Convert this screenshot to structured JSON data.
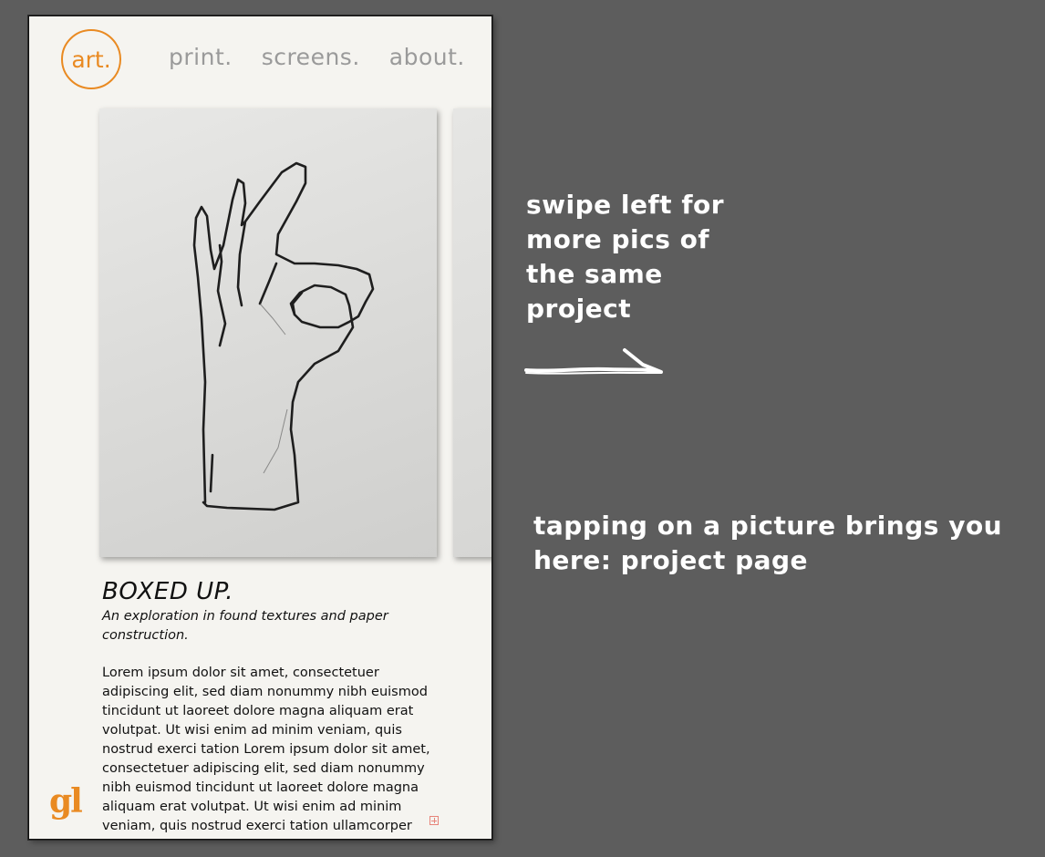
{
  "phone": {
    "logo": "art.",
    "nav": [
      "print.",
      "screens.",
      "about."
    ],
    "project": {
      "title": "BOXED UP.",
      "subtitle": "An exploration in found textures and paper construction.",
      "body": "Lorem ipsum dolor sit amet, consectetuer adipiscing elit, sed diam nonummy nibh euismod tincidunt ut laoreet dolore magna aliquam erat volutpat. Ut wisi enim ad minim veniam, quis nostrud exerci tation Lorem ipsum dolor sit amet, consectetuer adipiscing elit, sed diam nonummy nibh euismod tincidunt ut laoreet dolore magna aliquam erat volutpat. Ut wisi enim ad minim veniam, quis nostrud exerci tation ullamcorper"
    },
    "footer_logo": "gl"
  },
  "annotations": {
    "swipe": "swipe left for more pics of the same project",
    "tap": "tapping on a picture brings you here: project page"
  },
  "colors": {
    "accent": "#e98a22",
    "background": "#5d5d5d",
    "page": "#f5f4f0",
    "nav_text": "#9a9a9a"
  }
}
